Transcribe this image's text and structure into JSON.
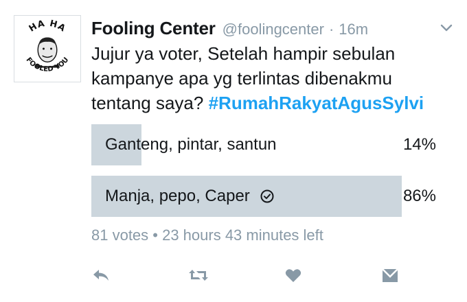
{
  "author": {
    "display_name": "Fooling Center",
    "handle": "@foolingcenter",
    "separator": "·",
    "time": "16m",
    "avatar": {
      "top_text": "HA HA",
      "bottom_text": "FOOLED YOU"
    }
  },
  "tweet": {
    "text": "Jujur ya voter, Setelah hampir sebulan kampanye apa yg terlintas dibenakmu tentang saya? ",
    "hashtag": "#RumahRakyatAgusSylvi"
  },
  "poll": {
    "options": [
      {
        "label": "Ganteng, pintar, santun",
        "percent_label": "14%",
        "percent": 14,
        "selected": false
      },
      {
        "label": "Manja, pepo, Caper",
        "percent_label": "86%",
        "percent": 86,
        "selected": true
      }
    ],
    "meta": "81 votes • 23 hours 43 minutes left"
  },
  "actions": {
    "icons": [
      "reply-icon",
      "retweet-icon",
      "like-icon",
      "direct-message-icon",
      "chevron-down-icon",
      "check-circle-icon"
    ]
  },
  "colors": {
    "bar": "#ccd6dd",
    "hashtag": "#1da1f2",
    "muted": "#8899a6",
    "icon": "#8899a6"
  }
}
